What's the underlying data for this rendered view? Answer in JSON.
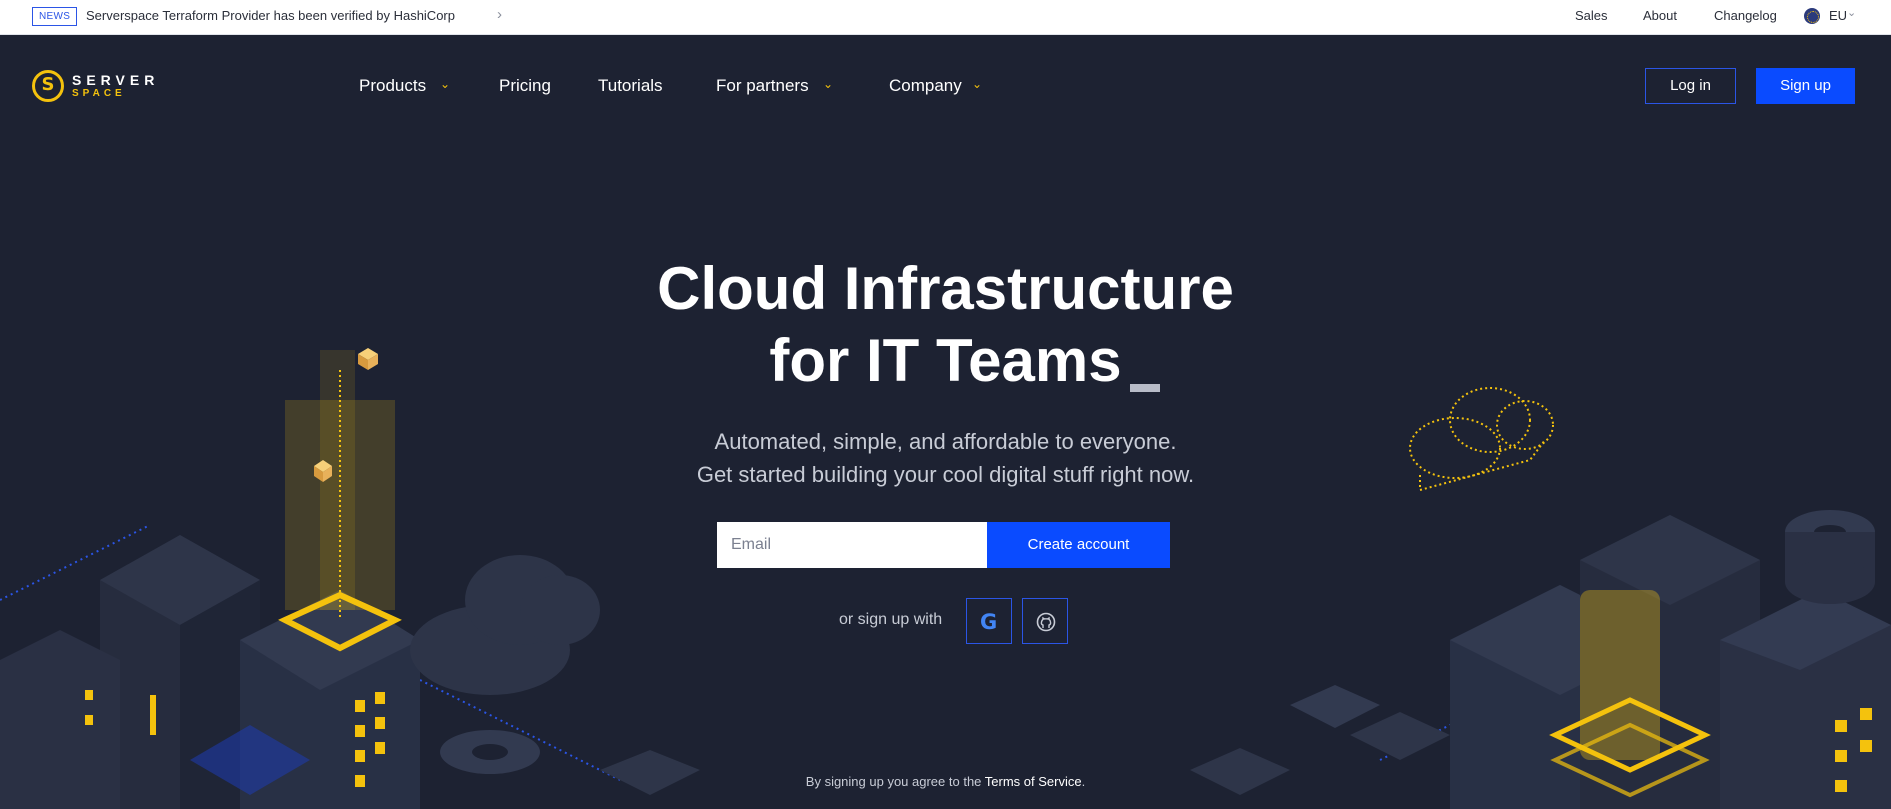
{
  "announcement": {
    "badge": "NEWS",
    "text": "Serverspace Terraform Provider has been verified by HashiCorp",
    "arrow_icon": "chevron-right-icon"
  },
  "top_links": {
    "sales": "Sales",
    "about": "About",
    "changelog": "Changelog",
    "region": "EU"
  },
  "brand": {
    "name_top": "SERVER",
    "name_bottom": "SPACE",
    "accent_color": "#f4c20d"
  },
  "nav": {
    "products": "Products",
    "pricing": "Pricing",
    "tutorials": "Tutorials",
    "for_partners": "For partners",
    "company": "Company"
  },
  "auth": {
    "login": "Log in",
    "signup": "Sign up"
  },
  "hero": {
    "title_line1": "Cloud Infrastructure",
    "title_line2": "for  IT Teams",
    "subtitle_line1": "Automated, simple, and affordable to everyone.",
    "subtitle_line2": "Get started building your cool digital stuff right now."
  },
  "signup_form": {
    "email_placeholder": "Email",
    "email_value": "",
    "submit": "Create account",
    "or_text": "or sign up with",
    "providers": [
      "google-icon",
      "github-icon"
    ]
  },
  "terms": {
    "prefix": "By signing up you agree to the ",
    "link": "Terms of Service",
    "suffix": "."
  },
  "colors": {
    "background": "#1d2232",
    "primary": "#0a4bff",
    "accent": "#f4c20d"
  }
}
